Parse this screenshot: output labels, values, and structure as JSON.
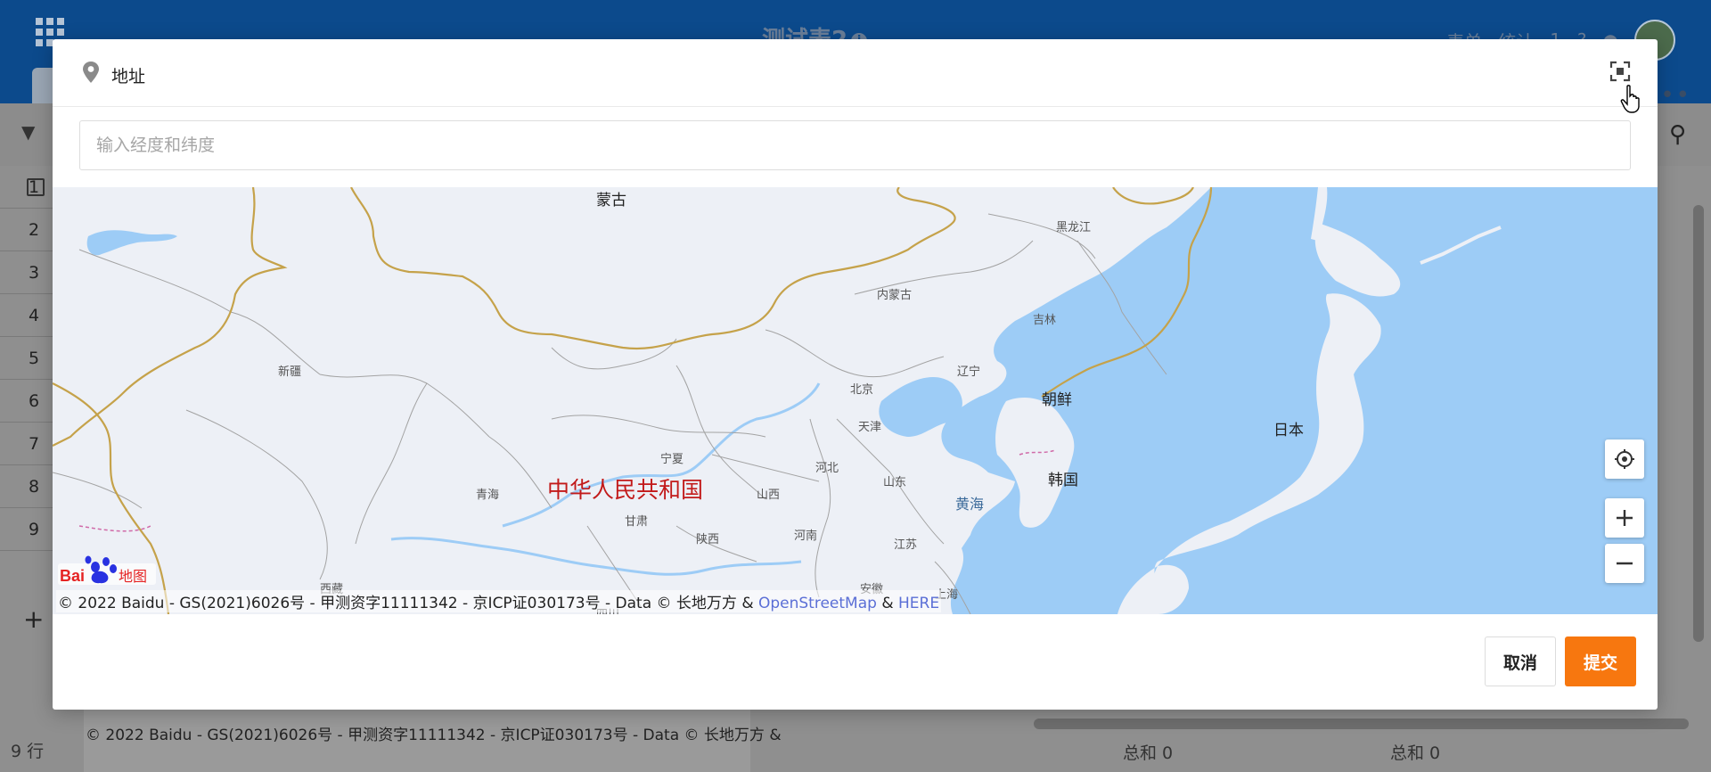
{
  "background": {
    "app_title": "测试表2",
    "info_icon": "i",
    "topbar_items": [
      "表单",
      "统计",
      "1"
    ],
    "row_numbers": [
      "1",
      "2",
      "3",
      "4",
      "5",
      "6",
      "7",
      "8",
      "9"
    ],
    "add_row_icon": "+",
    "row_count": "9 行",
    "sum_label_1": "总和 0",
    "sum_label_2": "总和 0",
    "bg_copyright": "© 2022 Baidu - GS(2021)6026号 - 甲测资字11111342 - 京ICP证030173号 - Data © 长地万方 &"
  },
  "modal": {
    "title": "地址",
    "input": {
      "value": "",
      "placeholder": "输入经度和纬度"
    },
    "buttons": {
      "cancel": "取消",
      "submit": "提交"
    }
  },
  "map": {
    "labels": {
      "menggu": "蒙古",
      "heilongjiang": "黑龙江",
      "neimenggu": "内蒙古",
      "jilin": "吉林",
      "xinjiang": "新疆",
      "liaoning": "辽宁",
      "beijing": "北京",
      "tianjin": "天津",
      "chaoxian": "朝鲜",
      "riben": "日本",
      "ningxia": "宁夏",
      "hebei": "河北",
      "qinghai": "青海",
      "country": "中华人民共和国",
      "shanxi": "山西",
      "shandong": "山东",
      "hanguo": "韩国",
      "huanghai": "黄海",
      "gansu": "甘肃",
      "henan": "河南",
      "shaanxi": "陕西",
      "jiangsu": "江苏",
      "anhui": "安徽",
      "shanghai": "上海",
      "xizang": "西藏",
      "sichuan": "四川"
    },
    "logo_text": "地图",
    "copyright_text": "© 2022 Baidu - GS(2021)6026号 - 甲测资字11111342 - 京ICP证030173号 - Data © 长地万方 & ",
    "osm_link": "OpenStreetMap",
    "amp": " & ",
    "here_link": "HERE",
    "colors": {
      "sea": "#9dccf6",
      "land": "#edf0f6",
      "border": "#c5a24a",
      "accent": "#f7770f"
    }
  }
}
